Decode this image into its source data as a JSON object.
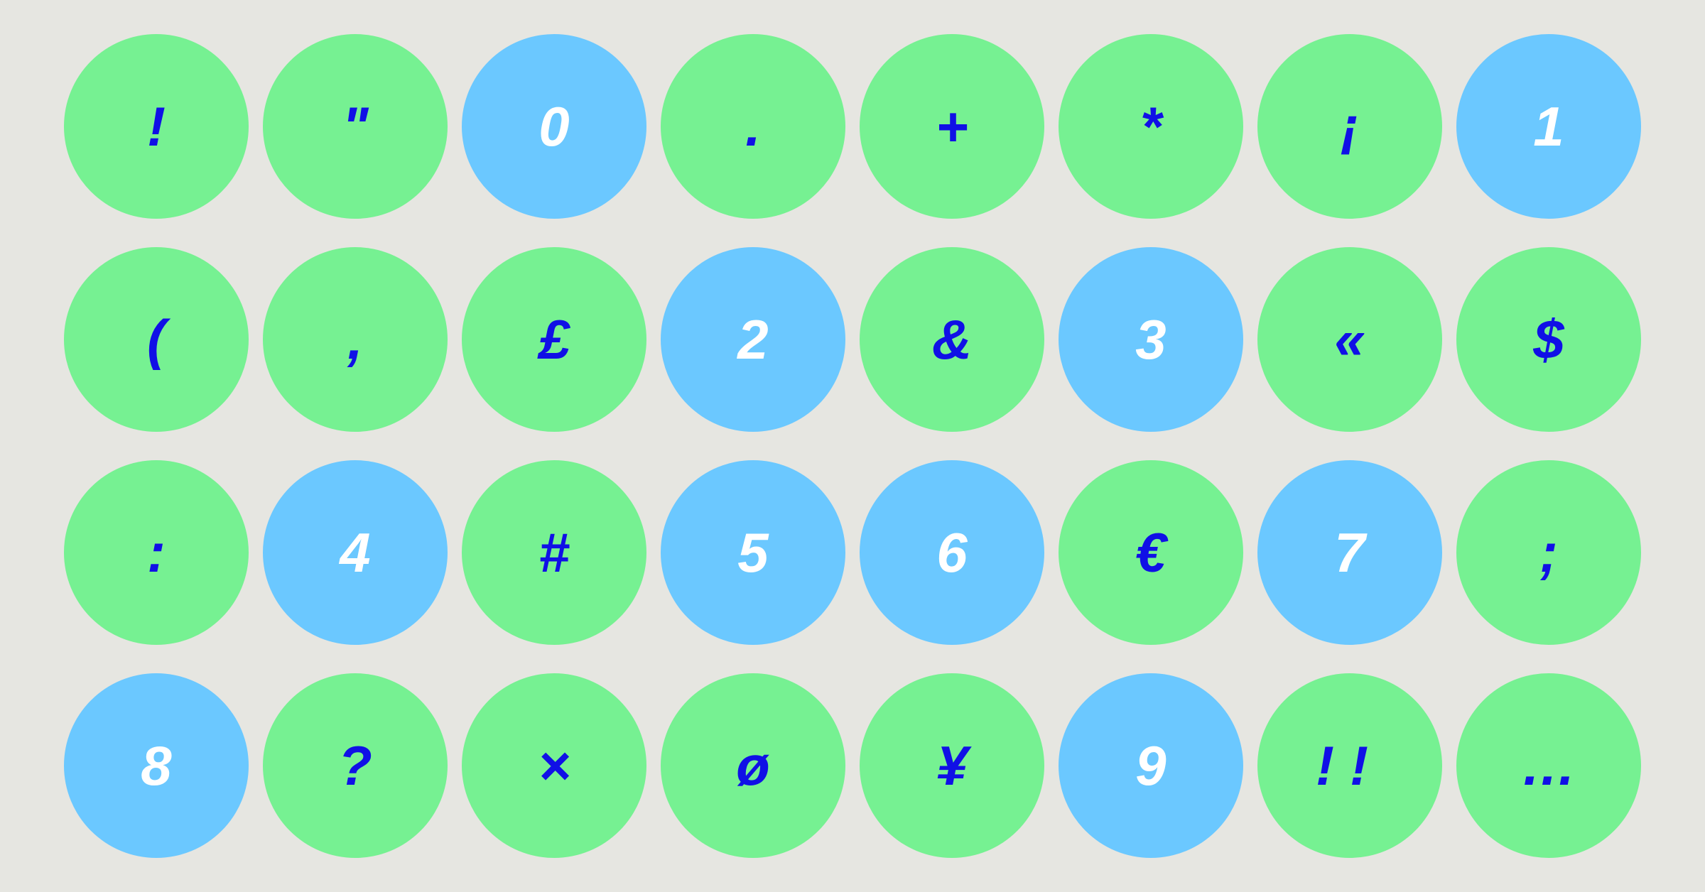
{
  "colors": {
    "background": "#e6e6e1",
    "symbol_key": "#76f192",
    "digit_key": "#6bc8ff",
    "symbol_text": "#1010e6",
    "digit_text": "#ffffff"
  },
  "rows": [
    [
      {
        "label": "!",
        "kind": "symbol",
        "name": "key-exclamation"
      },
      {
        "label": "\"",
        "kind": "symbol",
        "name": "key-double-quote"
      },
      {
        "label": "0",
        "kind": "digit",
        "name": "key-0"
      },
      {
        "label": ".",
        "kind": "symbol",
        "name": "key-period"
      },
      {
        "label": "+",
        "kind": "symbol",
        "name": "key-plus"
      },
      {
        "label": "*",
        "kind": "symbol",
        "name": "key-asterisk"
      },
      {
        "label": "¡",
        "kind": "symbol",
        "name": "key-inverted-exclamation"
      },
      {
        "label": "1",
        "kind": "digit",
        "name": "key-1"
      }
    ],
    [
      {
        "label": "(",
        "kind": "symbol",
        "name": "key-left-paren"
      },
      {
        "label": ",",
        "kind": "symbol",
        "name": "key-comma"
      },
      {
        "label": "£",
        "kind": "symbol",
        "name": "key-pound"
      },
      {
        "label": "2",
        "kind": "digit",
        "name": "key-2"
      },
      {
        "label": "&",
        "kind": "symbol",
        "name": "key-ampersand"
      },
      {
        "label": "3",
        "kind": "digit",
        "name": "key-3"
      },
      {
        "label": "«",
        "kind": "symbol",
        "name": "key-guillemet"
      },
      {
        "label": "$",
        "kind": "symbol",
        "name": "key-dollar"
      }
    ],
    [
      {
        "label": ":",
        "kind": "symbol",
        "name": "key-colon"
      },
      {
        "label": "4",
        "kind": "digit",
        "name": "key-4"
      },
      {
        "label": "#",
        "kind": "symbol",
        "name": "key-hash"
      },
      {
        "label": "5",
        "kind": "digit",
        "name": "key-5"
      },
      {
        "label": "6",
        "kind": "digit",
        "name": "key-6"
      },
      {
        "label": "€",
        "kind": "symbol",
        "name": "key-euro"
      },
      {
        "label": "7",
        "kind": "digit",
        "name": "key-7"
      },
      {
        "label": ";",
        "kind": "symbol",
        "name": "key-semicolon"
      }
    ],
    [
      {
        "label": "8",
        "kind": "digit",
        "name": "key-8"
      },
      {
        "label": "?",
        "kind": "symbol",
        "name": "key-question"
      },
      {
        "label": "×",
        "kind": "symbol",
        "name": "key-multiply"
      },
      {
        "label": "ø",
        "kind": "symbol",
        "name": "key-o-slash"
      },
      {
        "label": "¥",
        "kind": "symbol",
        "name": "key-yen"
      },
      {
        "label": "9",
        "kind": "digit",
        "name": "key-9"
      },
      {
        "label": "!!",
        "kind": "symbol",
        "name": "key-double-exclamation"
      },
      {
        "label": "…",
        "kind": "symbol",
        "name": "key-ellipsis"
      }
    ]
  ]
}
